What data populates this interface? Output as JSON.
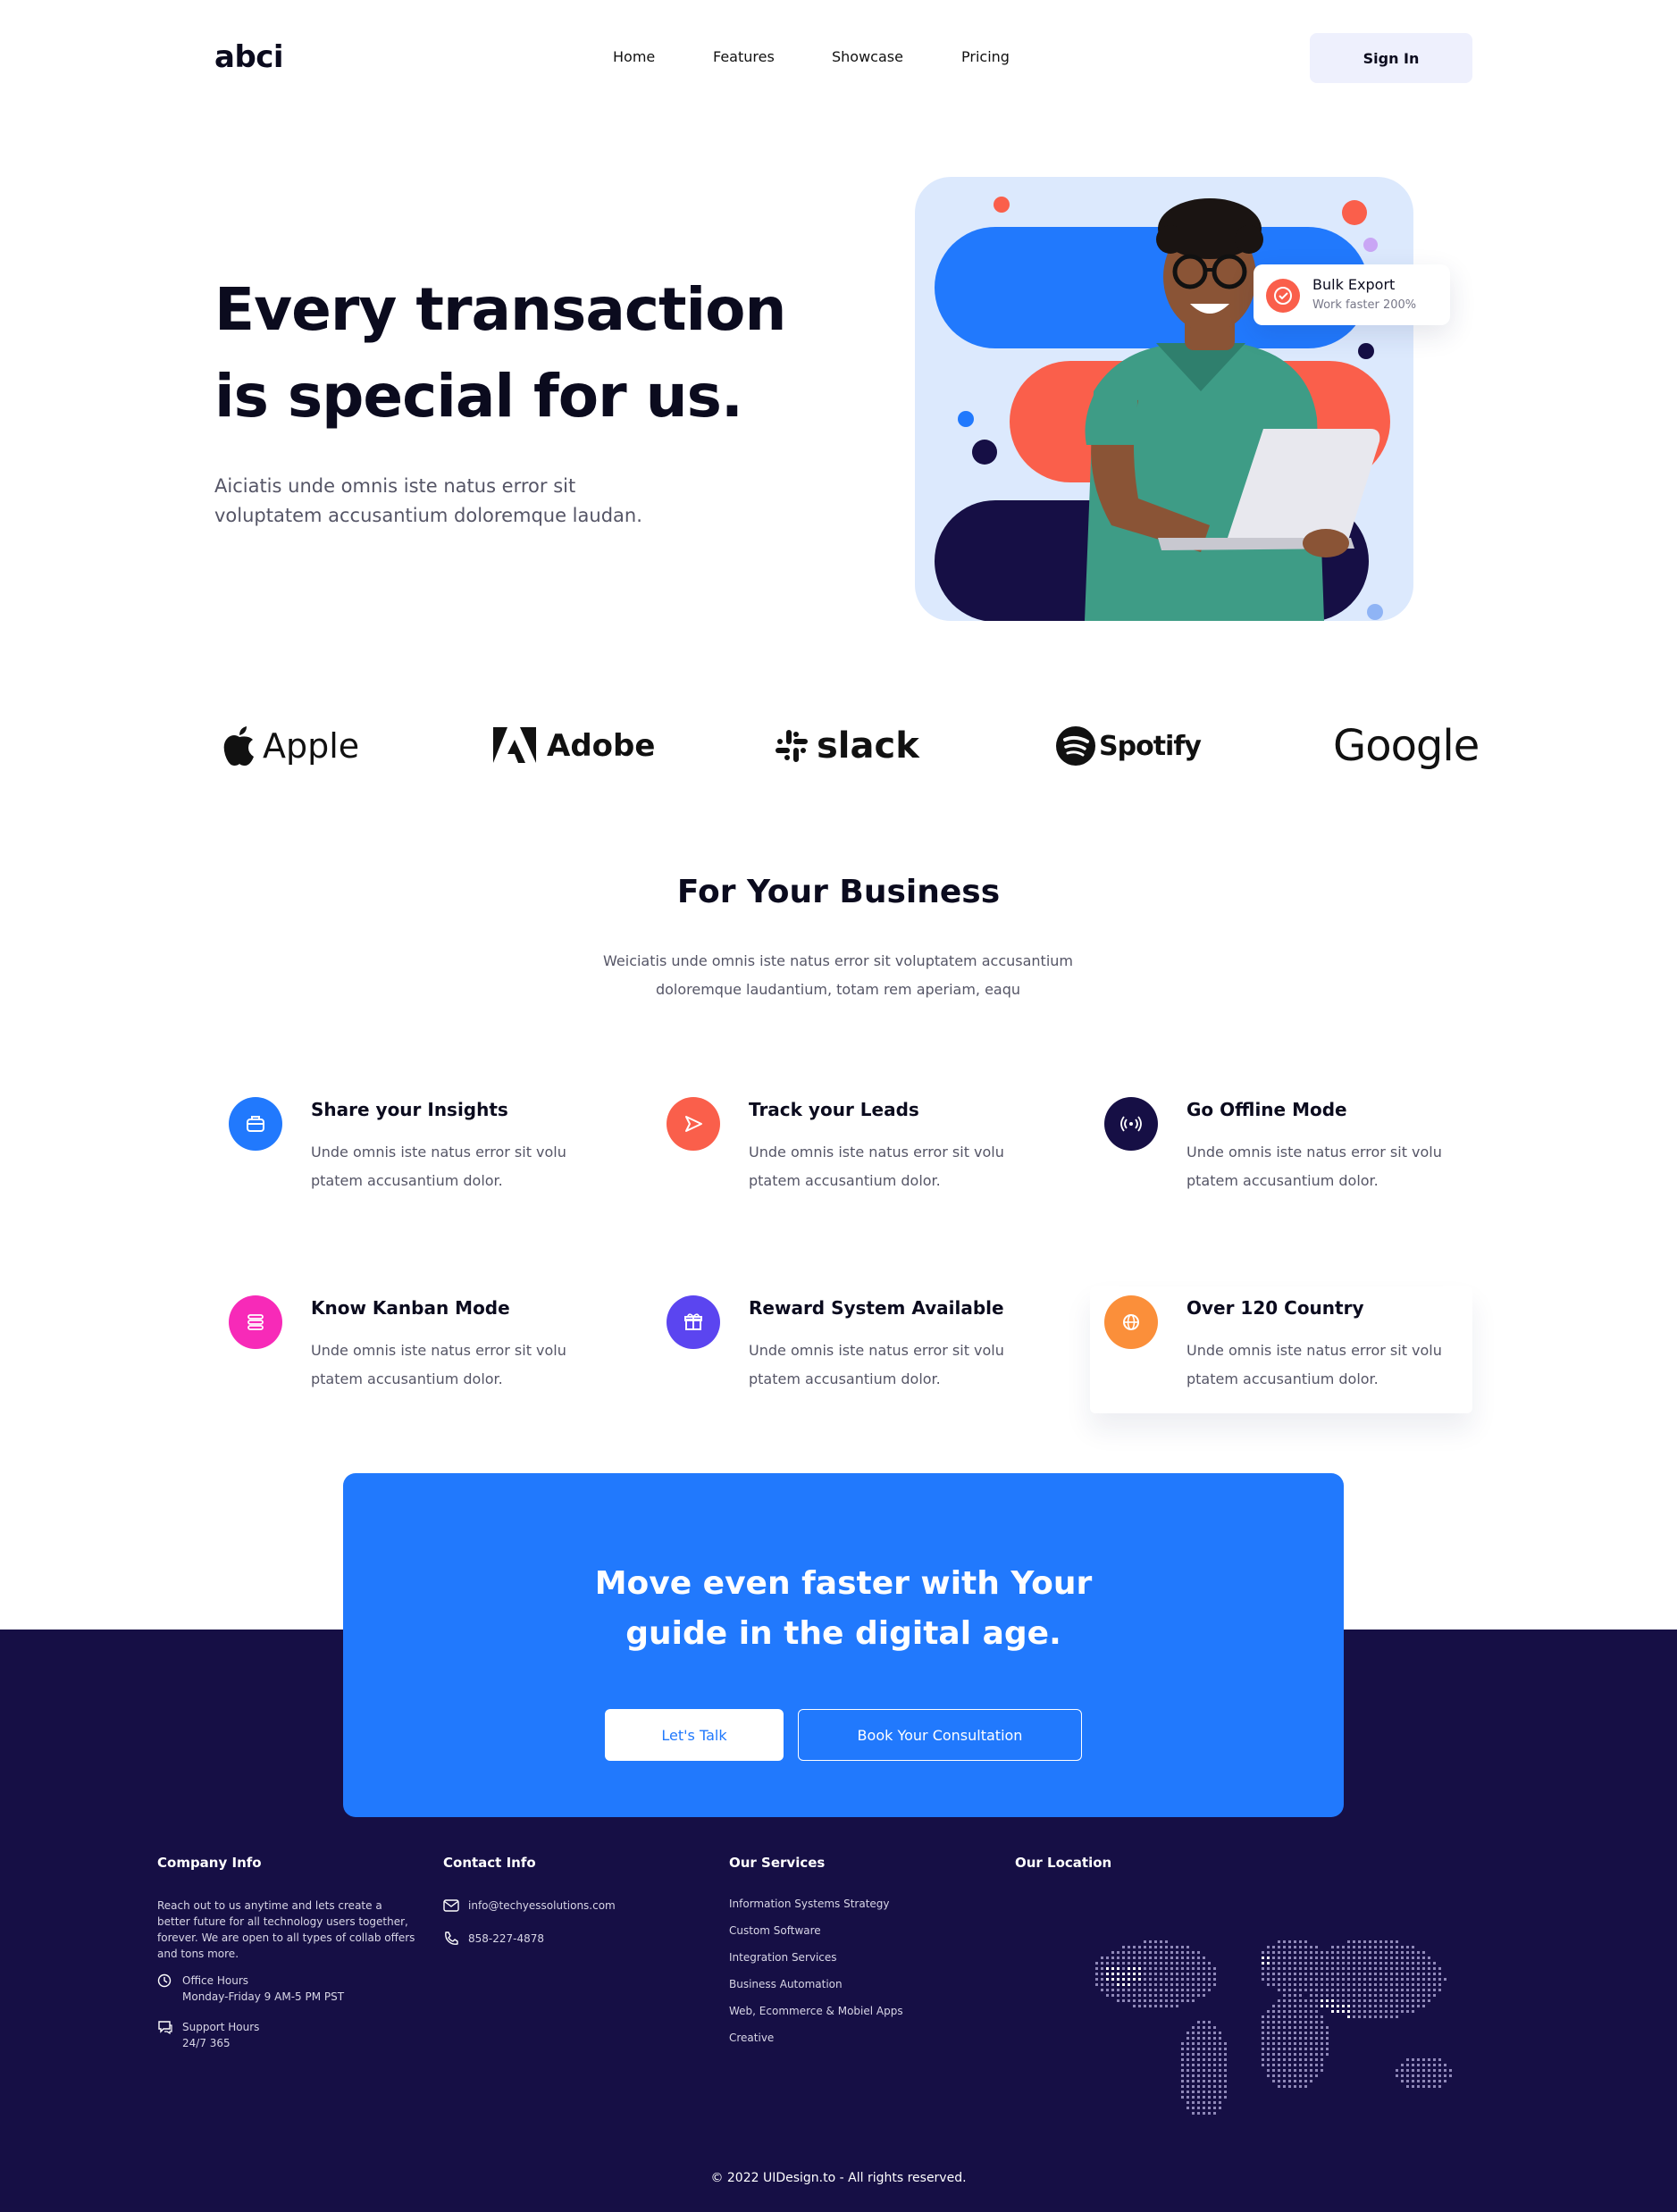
{
  "nav": {
    "logo": "abci",
    "links": [
      "Home",
      "Features",
      "Showcase",
      "Pricing"
    ],
    "signin_label": "Sign In"
  },
  "hero": {
    "title_line1": "Every transaction",
    "title_line2": "is special for us.",
    "subtitle_line1": "Aiciatis unde omnis iste natus error sit",
    "subtitle_line2": "voluptatem accusantium doloremque laudan.",
    "badge_title": "Bulk Export",
    "badge_sub": "Work faster 200%"
  },
  "brands": [
    "Apple",
    "Adobe",
    "slack",
    "Spotify",
    "Google"
  ],
  "business": {
    "title": "For Your Business",
    "subtitle_line1": "Weiciatis unde omnis iste natus error sit voluptatem accusantium",
    "subtitle_line2": "doloremque laudantium, totam rem aperiam, eaqu",
    "features": [
      {
        "title": "Share your Insights",
        "desc": "Unde omnis iste natus error sit volu ptatem accusantium dolor.",
        "icon": "briefcase-icon",
        "color": "#2179fd"
      },
      {
        "title": "Track your Leads",
        "desc": "Unde omnis iste natus error sit volu ptatem accusantium dolor.",
        "icon": "send-icon",
        "color": "#fa5f4b"
      },
      {
        "title": "Go Offline Mode",
        "desc": "Unde omnis iste natus error sit volu ptatem accusantium dolor.",
        "icon": "broadcast-icon",
        "color": "#160f45"
      },
      {
        "title": "Know Kanban Mode",
        "desc": "Unde omnis iste natus error sit volu ptatem accusantium dolor.",
        "icon": "list-icon",
        "color": "#f72ab8"
      },
      {
        "title": "Reward System Available",
        "desc": "Unde omnis iste natus error sit volu ptatem accusantium dolor.",
        "icon": "gift-icon",
        "color": "#5b45f0"
      },
      {
        "title": "Over 120 Country",
        "desc": "Unde omnis iste natus error sit volu ptatem accusantium dolor.",
        "icon": "globe-icon",
        "color": "#fb8f3a"
      }
    ]
  },
  "cta": {
    "title_line1": "Move even faster with Your",
    "title_line2": "guide in the digital age.",
    "talk_label": "Let's Talk",
    "book_label": "Book Your Consultation"
  },
  "footer": {
    "company": {
      "title": "Company Info",
      "desc_lines": [
        "Reach out to us anytime and lets create a",
        "better future for all technology users together,",
        "forever. We are open to all types of collab offers",
        "and tons more."
      ],
      "office_label": "Office Hours",
      "office_value": "Monday-Friday 9 AM-5 PM PST",
      "support_label": "Support Hours",
      "support_value": "24/7 365"
    },
    "contact": {
      "title": "Contact Info",
      "email": "info@techyessolutions.com",
      "phone": "858-227-4878"
    },
    "services": {
      "title": "Our Services",
      "items": [
        "Information Systems Strategy",
        "Custom Software",
        "Integration Services",
        "Business Automation",
        "Web, Ecommerce & Mobiel Apps",
        "Creative"
      ]
    },
    "location": {
      "title": "Our Location"
    },
    "copyright": "© 2022 UIDesign.to - All rights reserved."
  },
  "colors": {
    "accent_blue": "#2179fd",
    "accent_red": "#fa5f4b",
    "navy": "#160f45"
  }
}
